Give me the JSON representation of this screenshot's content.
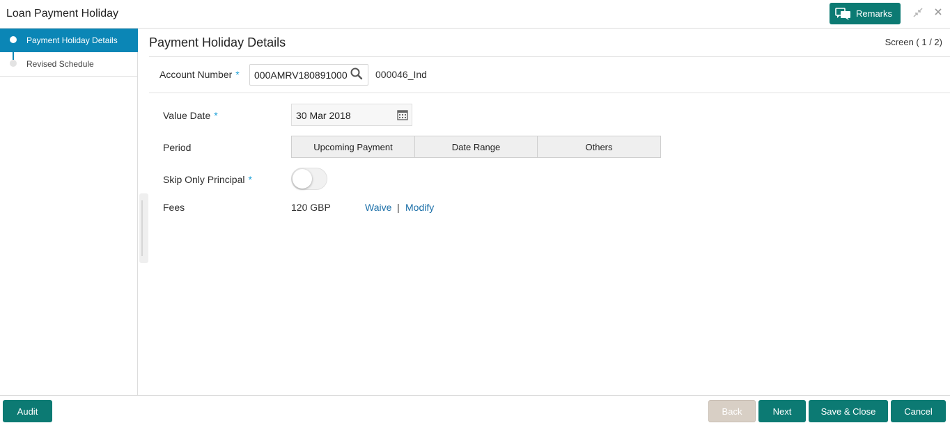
{
  "window": {
    "title": "Loan Payment Holiday"
  },
  "header": {
    "remarks_label": "Remarks",
    "minimize_icon": "minimize-icon",
    "close_icon": "close-icon"
  },
  "colors": {
    "primary": "#0c7a73",
    "nav_active": "#0b86b6",
    "required": "#1aa0d8",
    "link": "#1b6fa8"
  },
  "nav": {
    "items": [
      {
        "label": "Payment Holiday Details",
        "active": true
      },
      {
        "label": "Revised Schedule",
        "active": false
      }
    ]
  },
  "main": {
    "title": "Payment Holiday Details",
    "screen_indicator": "Screen ( 1 / 2)",
    "account": {
      "label": "Account Number",
      "required_mark": "*",
      "value": "000AMRV180891000",
      "description": "000046_Ind"
    },
    "value_date": {
      "label": "Value Date",
      "required_mark": "*",
      "value": "30 Mar 2018"
    },
    "period": {
      "label": "Period",
      "options": [
        "Upcoming Payment",
        "Date Range",
        "Others"
      ]
    },
    "skip_principal": {
      "label": "Skip Only Principal",
      "required_mark": "*",
      "on": false
    },
    "fees": {
      "label": "Fees",
      "value": "120 GBP",
      "waive_label": "Waive",
      "separator": "|",
      "modify_label": "Modify"
    }
  },
  "footer": {
    "audit_label": "Audit",
    "back_label": "Back",
    "next_label": "Next",
    "save_close_label": "Save & Close",
    "cancel_label": "Cancel"
  }
}
